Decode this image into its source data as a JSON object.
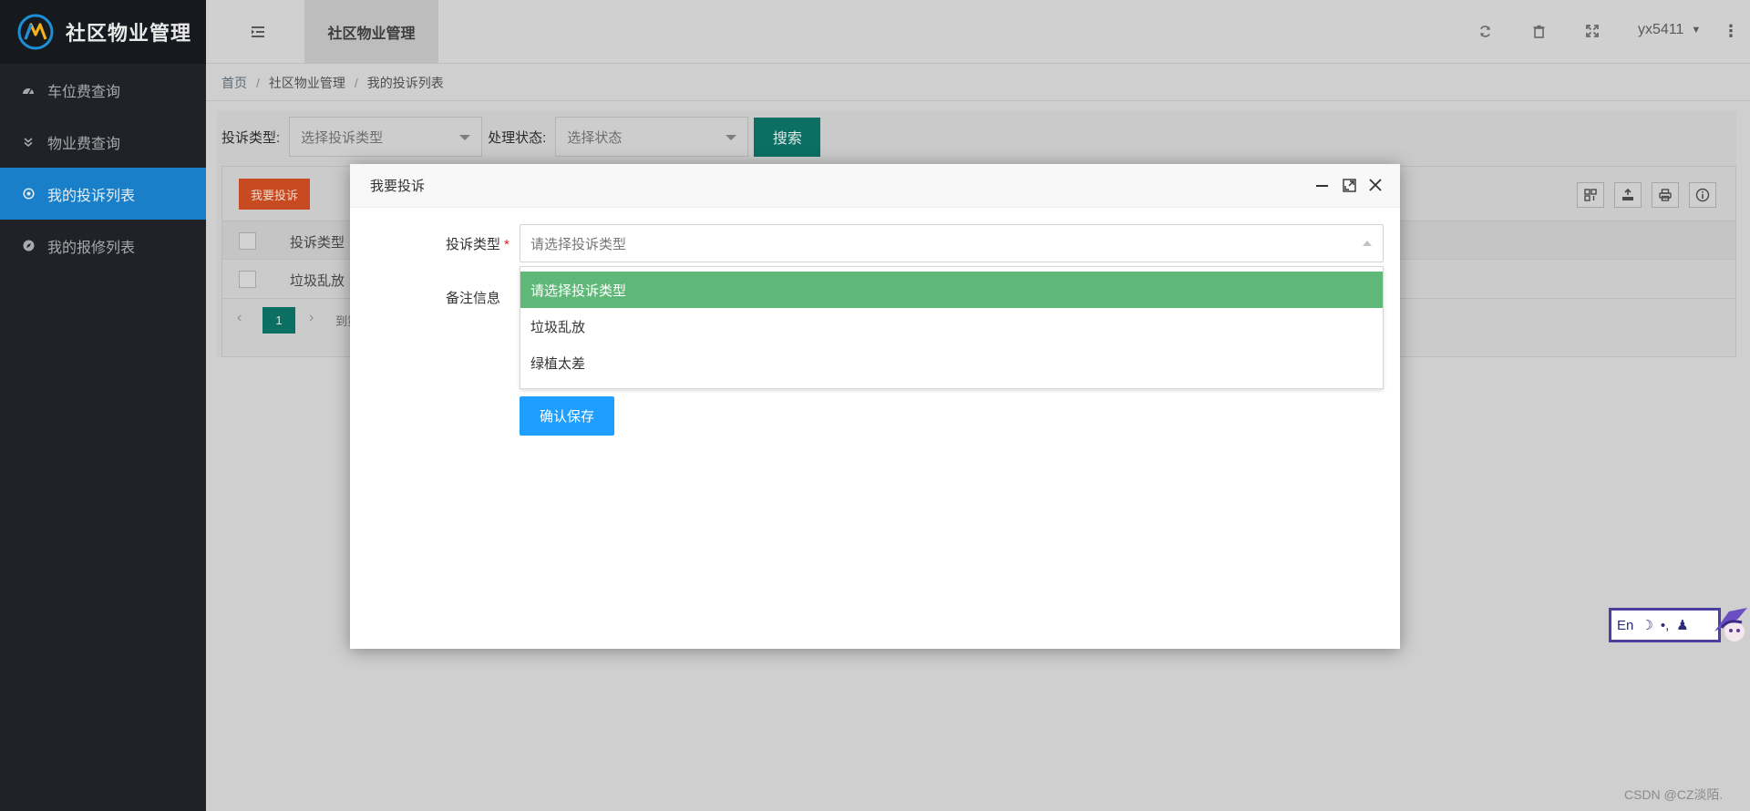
{
  "app": {
    "logo_text": "社区物业管理",
    "brand_colors": {
      "sidebar_bg": "#1f2328",
      "active_nav": "#1a7fc9",
      "teal": "#0b6f64",
      "orange": "#c84a20",
      "green_option": "#5fb878",
      "blue_button": "#1e9fff"
    }
  },
  "sidebar": {
    "items": [
      {
        "label": "车位费查询",
        "icon": "dashboard-icon",
        "active": false
      },
      {
        "label": "物业费查询",
        "icon": "chevron-double-down-icon",
        "active": false
      },
      {
        "label": "我的投诉列表",
        "icon": "target-icon",
        "active": true
      },
      {
        "label": "我的报修列表",
        "icon": "compass-icon",
        "active": false
      }
    ]
  },
  "header": {
    "tab_title": "社区物业管理",
    "username": "yx5411",
    "icons": [
      "menu-toggle-icon",
      "refresh-icon",
      "trash-icon",
      "fullscreen-icon",
      "more-vertical-icon"
    ]
  },
  "breadcrumb": {
    "home": "首页",
    "level1": "社区物业管理",
    "level2": "我的投诉列表",
    "separator": "/"
  },
  "filters": {
    "type_label": "投诉类型:",
    "type_placeholder": "选择投诉类型",
    "status_label": "处理状态:",
    "status_placeholder": "选择状态",
    "search_label": "搜索"
  },
  "table": {
    "add_button": "我要投诉",
    "columns": [
      "投诉类型"
    ],
    "rows": [
      [
        "垃圾乱放"
      ]
    ],
    "toolbar_icons": [
      "columns-icon",
      "export-icon",
      "print-icon",
      "info-icon"
    ],
    "pagination": {
      "current_page": "1",
      "goto_text": "到第"
    }
  },
  "modal": {
    "title": "我要投诉",
    "type_label": "投诉类型",
    "required_mark": "*",
    "type_placeholder": "请选择投诉类型",
    "remark_label": "备注信息",
    "options": [
      "请选择投诉类型",
      "垃圾乱放",
      "绿植太差"
    ],
    "selected_index": 0,
    "confirm_label": "确认保存"
  },
  "ime": {
    "text": "En"
  },
  "watermark": "CSDN @CZ淡陌."
}
